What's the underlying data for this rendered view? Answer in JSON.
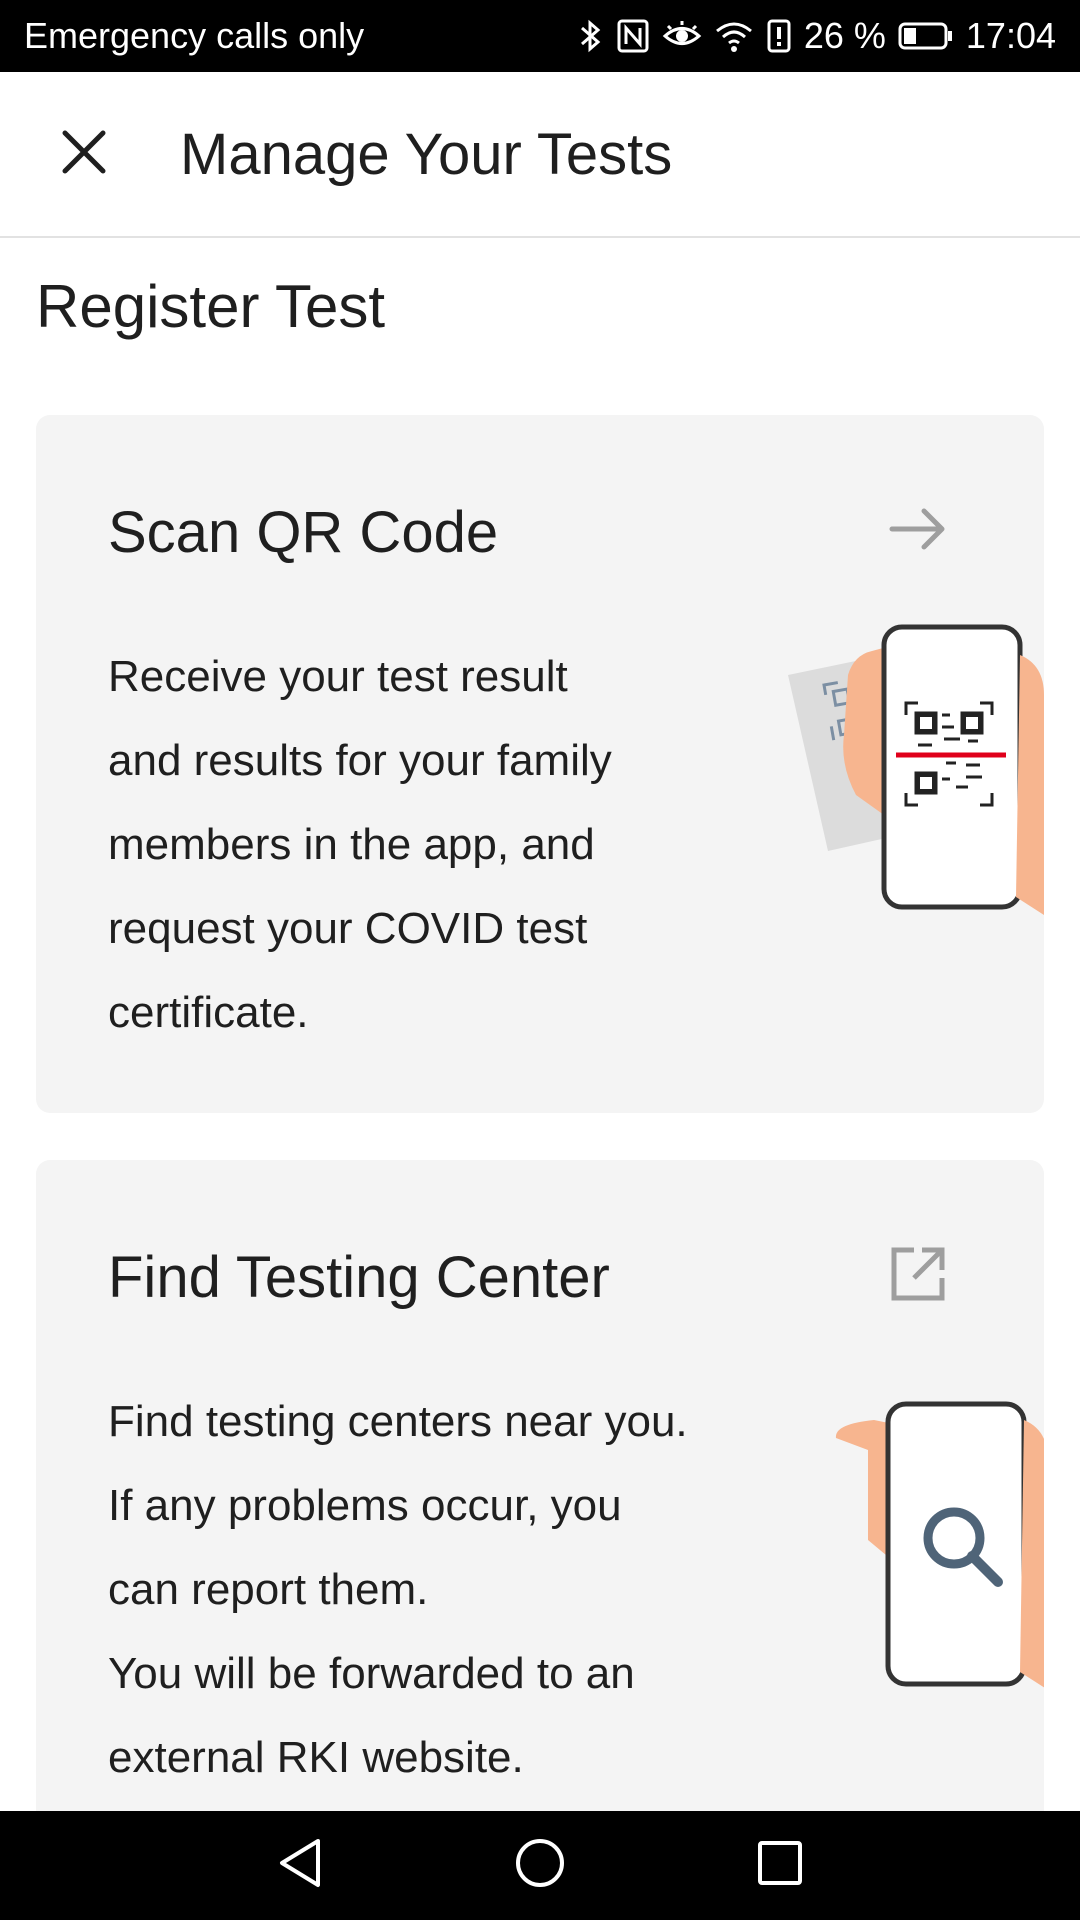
{
  "status_bar": {
    "carrier_text": "Emergency calls only",
    "battery_percent": "26 %",
    "time": "17:04",
    "icons": [
      "bluetooth-icon",
      "nfc-icon",
      "eye-comfort-icon",
      "wifi-icon",
      "battery-alert-icon",
      "battery-icon"
    ]
  },
  "header": {
    "close_icon": "close-icon",
    "title": "Manage Your Tests"
  },
  "section": {
    "title": "Register Test"
  },
  "cards": [
    {
      "title": "Scan QR Code",
      "action_icon": "arrow-right-icon",
      "body_lines": [
        "Receive your test result",
        "and results for your family",
        "members in the app, and",
        "request your COVID test",
        "certificate."
      ],
      "illustration": "phone-scanning-qr-illustration"
    },
    {
      "title": "Find Testing Center",
      "action_icon": "open-external-icon",
      "body_lines": [
        "Find testing centers near you.",
        "If any problems occur, you",
        "can report them.",
        "You will be forwarded to an",
        "external RKI website."
      ],
      "illustration": "phone-search-illustration"
    }
  ],
  "nav_bar": {
    "buttons": [
      "back-icon",
      "home-icon",
      "recents-icon"
    ]
  },
  "colors": {
    "card_background": "#f4f4f4",
    "accent_red": "#e0001b",
    "icon_gray": "#9e9e9e",
    "skin": "#f7b58f",
    "search_blue": "#4f6478"
  }
}
